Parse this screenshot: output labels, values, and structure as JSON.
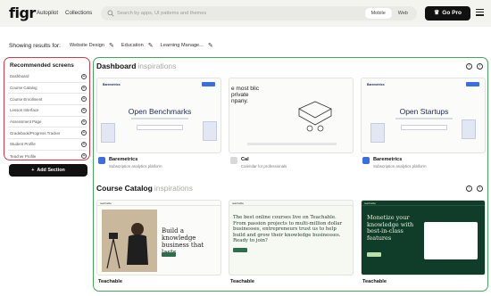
{
  "app": {
    "logo": "figr",
    "nav": [
      "Autopilot",
      "Collections"
    ],
    "search_placeholder": "Search by apps, UI patterns and themes",
    "platform_toggle": [
      "Mobile",
      "Web"
    ],
    "platform_selected": "Mobile",
    "cta": "Go Pro"
  },
  "filters": {
    "label": "Showing results for:",
    "chips": [
      "Website Design",
      "Education",
      "Learning Manage..."
    ]
  },
  "sidebar": {
    "title": "Recommended screens",
    "items": [
      "Dashboard",
      "Course Catalog",
      "Course Enrollment",
      "Lesson Interface",
      "Assessment Page",
      "Gradebook/Progress Tracker",
      "Student Profile",
      "Teacher Profile"
    ],
    "add_button": "Add Section"
  },
  "sections": [
    {
      "title": "Dashboard",
      "suffix": "inspirations",
      "cards": [
        {
          "thumb_heading": "Open Benchmarks",
          "thumb_brand": "Baremetrics",
          "name": "Baremetrics",
          "desc": "Subscription analytics platform",
          "icon_color": "#3b6fe0"
        },
        {
          "thumb_heading": "e most blic private npany.",
          "name": "Cal",
          "desc": "Calendar for professionals",
          "icon_color": "#d9d9d9"
        },
        {
          "thumb_heading": "Open Startups",
          "thumb_brand": "Baremetrics",
          "name": "Baremetrics",
          "desc": "Subscription analytics platform",
          "icon_color": "#3b6fe0"
        }
      ]
    },
    {
      "title": "Course Catalog",
      "suffix": "inspirations",
      "cards": [
        {
          "thumb_heading": "Build a knowledge business that lasts",
          "thumb_brand": "teachable",
          "name": "Teachable",
          "desc": ""
        },
        {
          "thumb_heading": "The best online courses live on Teachable. From passion projects to multi-million dollar businesses, entrepreneurs trust us to help build and grow their knowledge businesses. Ready to join?",
          "thumb_brand": "teachable",
          "name": "Teachable",
          "desc": ""
        },
        {
          "thumb_heading": "Monetize your knowledge with best-in-class features",
          "thumb_brand": "teachable",
          "name": "Teachable",
          "desc": ""
        }
      ]
    }
  ]
}
